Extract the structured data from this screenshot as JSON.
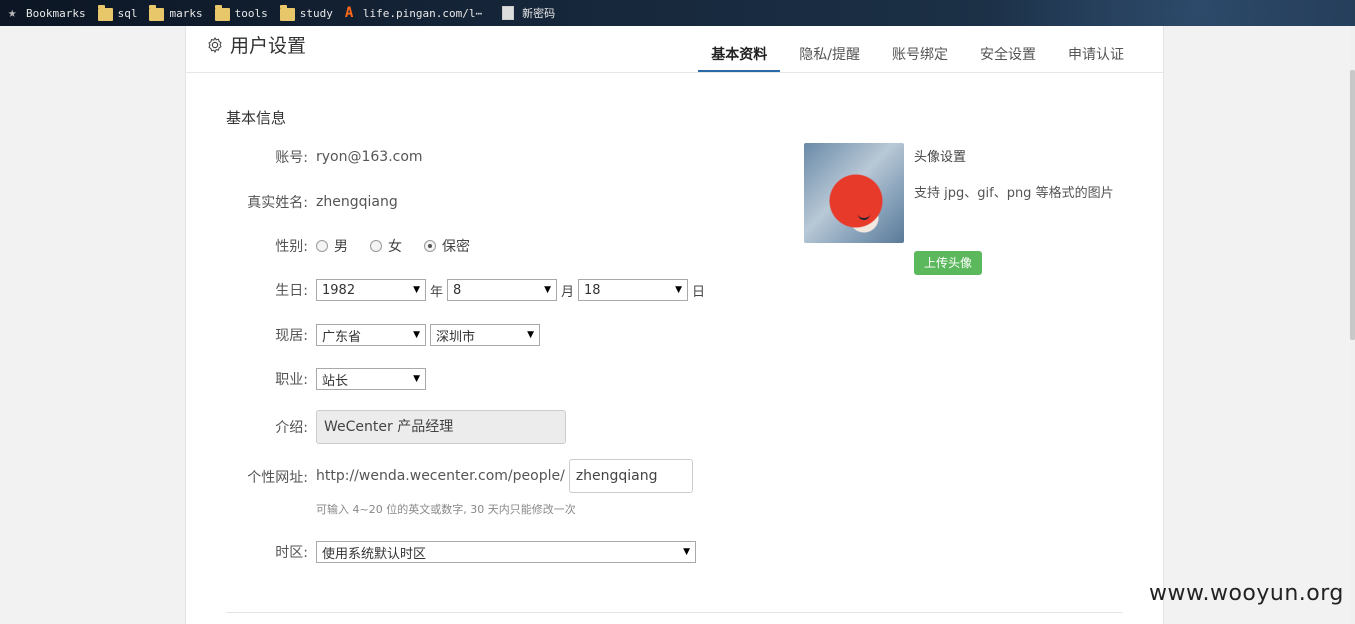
{
  "bookmarks": [
    {
      "label": "Bookmarks",
      "icon": "star-icon"
    },
    {
      "label": "sql",
      "icon": "folder-icon"
    },
    {
      "label": "marks",
      "icon": "folder-icon"
    },
    {
      "label": "tools",
      "icon": "folder-icon"
    },
    {
      "label": "study",
      "icon": "folder-icon"
    },
    {
      "label": "life.pingan.com/l⋯",
      "icon": "pingan-icon"
    },
    {
      "label": "新密码",
      "icon": "document-icon"
    }
  ],
  "header": {
    "title": "用户设置",
    "tabs": [
      {
        "label": "基本资料",
        "active": true
      },
      {
        "label": "隐私/提醒",
        "active": false
      },
      {
        "label": "账号绑定",
        "active": false
      },
      {
        "label": "安全设置",
        "active": false
      },
      {
        "label": "申请认证",
        "active": false
      }
    ]
  },
  "form": {
    "section_title": "基本信息",
    "account": {
      "label": "账号:",
      "value": "ryon@163.com"
    },
    "real_name": {
      "label": "真实姓名:",
      "value": "zhengqiang"
    },
    "gender": {
      "label": "性别:",
      "options": [
        {
          "label": "男",
          "checked": false
        },
        {
          "label": "女",
          "checked": false
        },
        {
          "label": "保密",
          "checked": true
        }
      ]
    },
    "birthday": {
      "label": "生日:",
      "year": "1982",
      "year_unit": "年",
      "month": "8",
      "month_unit": "月",
      "day": "18",
      "day_unit": "日"
    },
    "residence": {
      "label": "现居:",
      "province": "广东省",
      "city": "深圳市"
    },
    "occupation": {
      "label": "职业:",
      "value": "站长"
    },
    "intro": {
      "label": "介绍:",
      "value": "WeCenter 产品经理"
    },
    "url": {
      "label": "个性网址:",
      "prefix": "http://wenda.wecenter.com/people/",
      "value": "zhengqiang",
      "hint": "可输入 4~20 位的英文或数字, 30 天内只能修改一次"
    },
    "timezone": {
      "label": "时区:",
      "value": "使用系统默认时区"
    }
  },
  "avatar": {
    "title": "头像设置",
    "description": "支持 jpg、gif、png 等格式的图片",
    "upload_label": "上传头像",
    "button_color": "#5cb85c"
  },
  "watermark": "www.wooyun.org",
  "colors": {
    "accent": "#2a6aa8"
  }
}
